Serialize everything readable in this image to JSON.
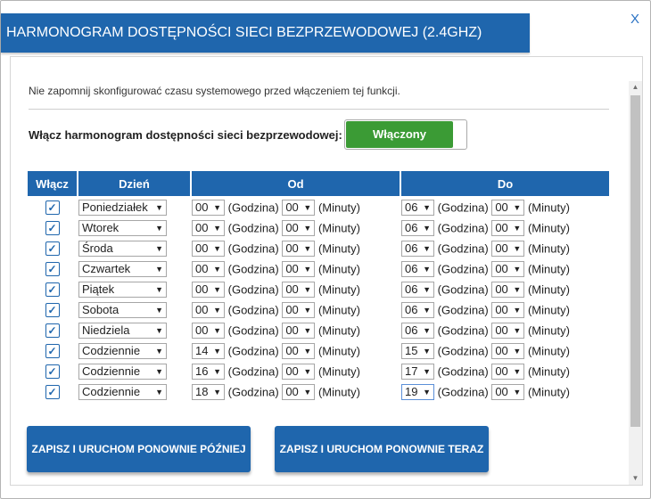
{
  "dialog": {
    "title": "HARMONOGRAM DOSTĘPNOŚCI SIECI BEZPRZEWODOWEJ (2.4GHZ)",
    "close_label": "X"
  },
  "notice": "Nie zapomnij skonfigurować czasu systemowego przed włączeniem tej funkcji.",
  "toggle": {
    "label": "Włącz harmonogram dostępności sieci bezprzewodowej:",
    "state": "Włączony"
  },
  "table": {
    "headers": {
      "enable": "Włącz",
      "day": "Dzień",
      "from": "Od",
      "to": "Do"
    },
    "hour_label": "(Godzina)",
    "minute_label": "(Minuty)",
    "rows": [
      {
        "day": "Poniedziałek",
        "from_h": "00",
        "from_m": "00",
        "to_h": "06",
        "to_m": "00"
      },
      {
        "day": "Wtorek",
        "from_h": "00",
        "from_m": "00",
        "to_h": "06",
        "to_m": "00"
      },
      {
        "day": "Środa",
        "from_h": "00",
        "from_m": "00",
        "to_h": "06",
        "to_m": "00"
      },
      {
        "day": "Czwartek",
        "from_h": "00",
        "from_m": "00",
        "to_h": "06",
        "to_m": "00"
      },
      {
        "day": "Piątek",
        "from_h": "00",
        "from_m": "00",
        "to_h": "06",
        "to_m": "00"
      },
      {
        "day": "Sobota",
        "from_h": "00",
        "from_m": "00",
        "to_h": "06",
        "to_m": "00"
      },
      {
        "day": "Niedziela",
        "from_h": "00",
        "from_m": "00",
        "to_h": "06",
        "to_m": "00"
      },
      {
        "day": "Codziennie",
        "from_h": "14",
        "from_m": "00",
        "to_h": "15",
        "to_m": "00"
      },
      {
        "day": "Codziennie",
        "from_h": "16",
        "from_m": "00",
        "to_h": "17",
        "to_m": "00"
      },
      {
        "day": "Codziennie",
        "from_h": "18",
        "from_m": "00",
        "to_h": "19",
        "to_m": "00"
      }
    ]
  },
  "buttons": {
    "save_later": "ZAPISZ I URUCHOM PONOWNIE PÓŹNIEJ",
    "save_now": "ZAPISZ I URUCHOM PONOWNIE TERAZ"
  },
  "icons": {
    "checkbox": "checkmark-icon",
    "dropdown": "dropdown-arrow-icon",
    "close": "close-icon"
  },
  "colors": {
    "primary": "#1f66ad",
    "toggle_on": "#3b9b35"
  }
}
